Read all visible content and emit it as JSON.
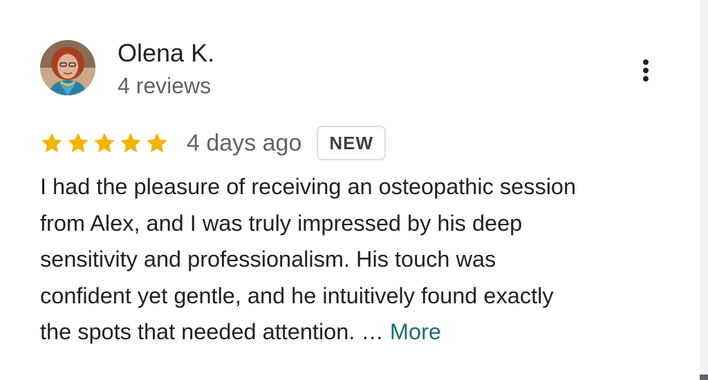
{
  "review": {
    "author_name": "Olena K.",
    "review_count": "4 reviews",
    "rating": 5,
    "rating_max": 5,
    "date": "4 days ago",
    "badge": "NEW",
    "text_lines": [
      "I had the pleasure of receiving an osteopathic session",
      "from Alex, and I was truly impressed by his deep",
      "sensitivity and professionalism. His touch was",
      "confident yet gentle, and he intuitively found exactly"
    ],
    "last_line": "the spots that needed attention.",
    "ellipsis": "…",
    "more_label": "More"
  },
  "icons": {
    "star": "star-icon",
    "menu": "more-vert-icon",
    "avatar": "user-avatar"
  },
  "colors": {
    "star": "#f4b400",
    "link": "#1a6b7c",
    "primary_text": "#202124",
    "secondary_text": "#5f6368",
    "badge_border": "#dadce0"
  }
}
